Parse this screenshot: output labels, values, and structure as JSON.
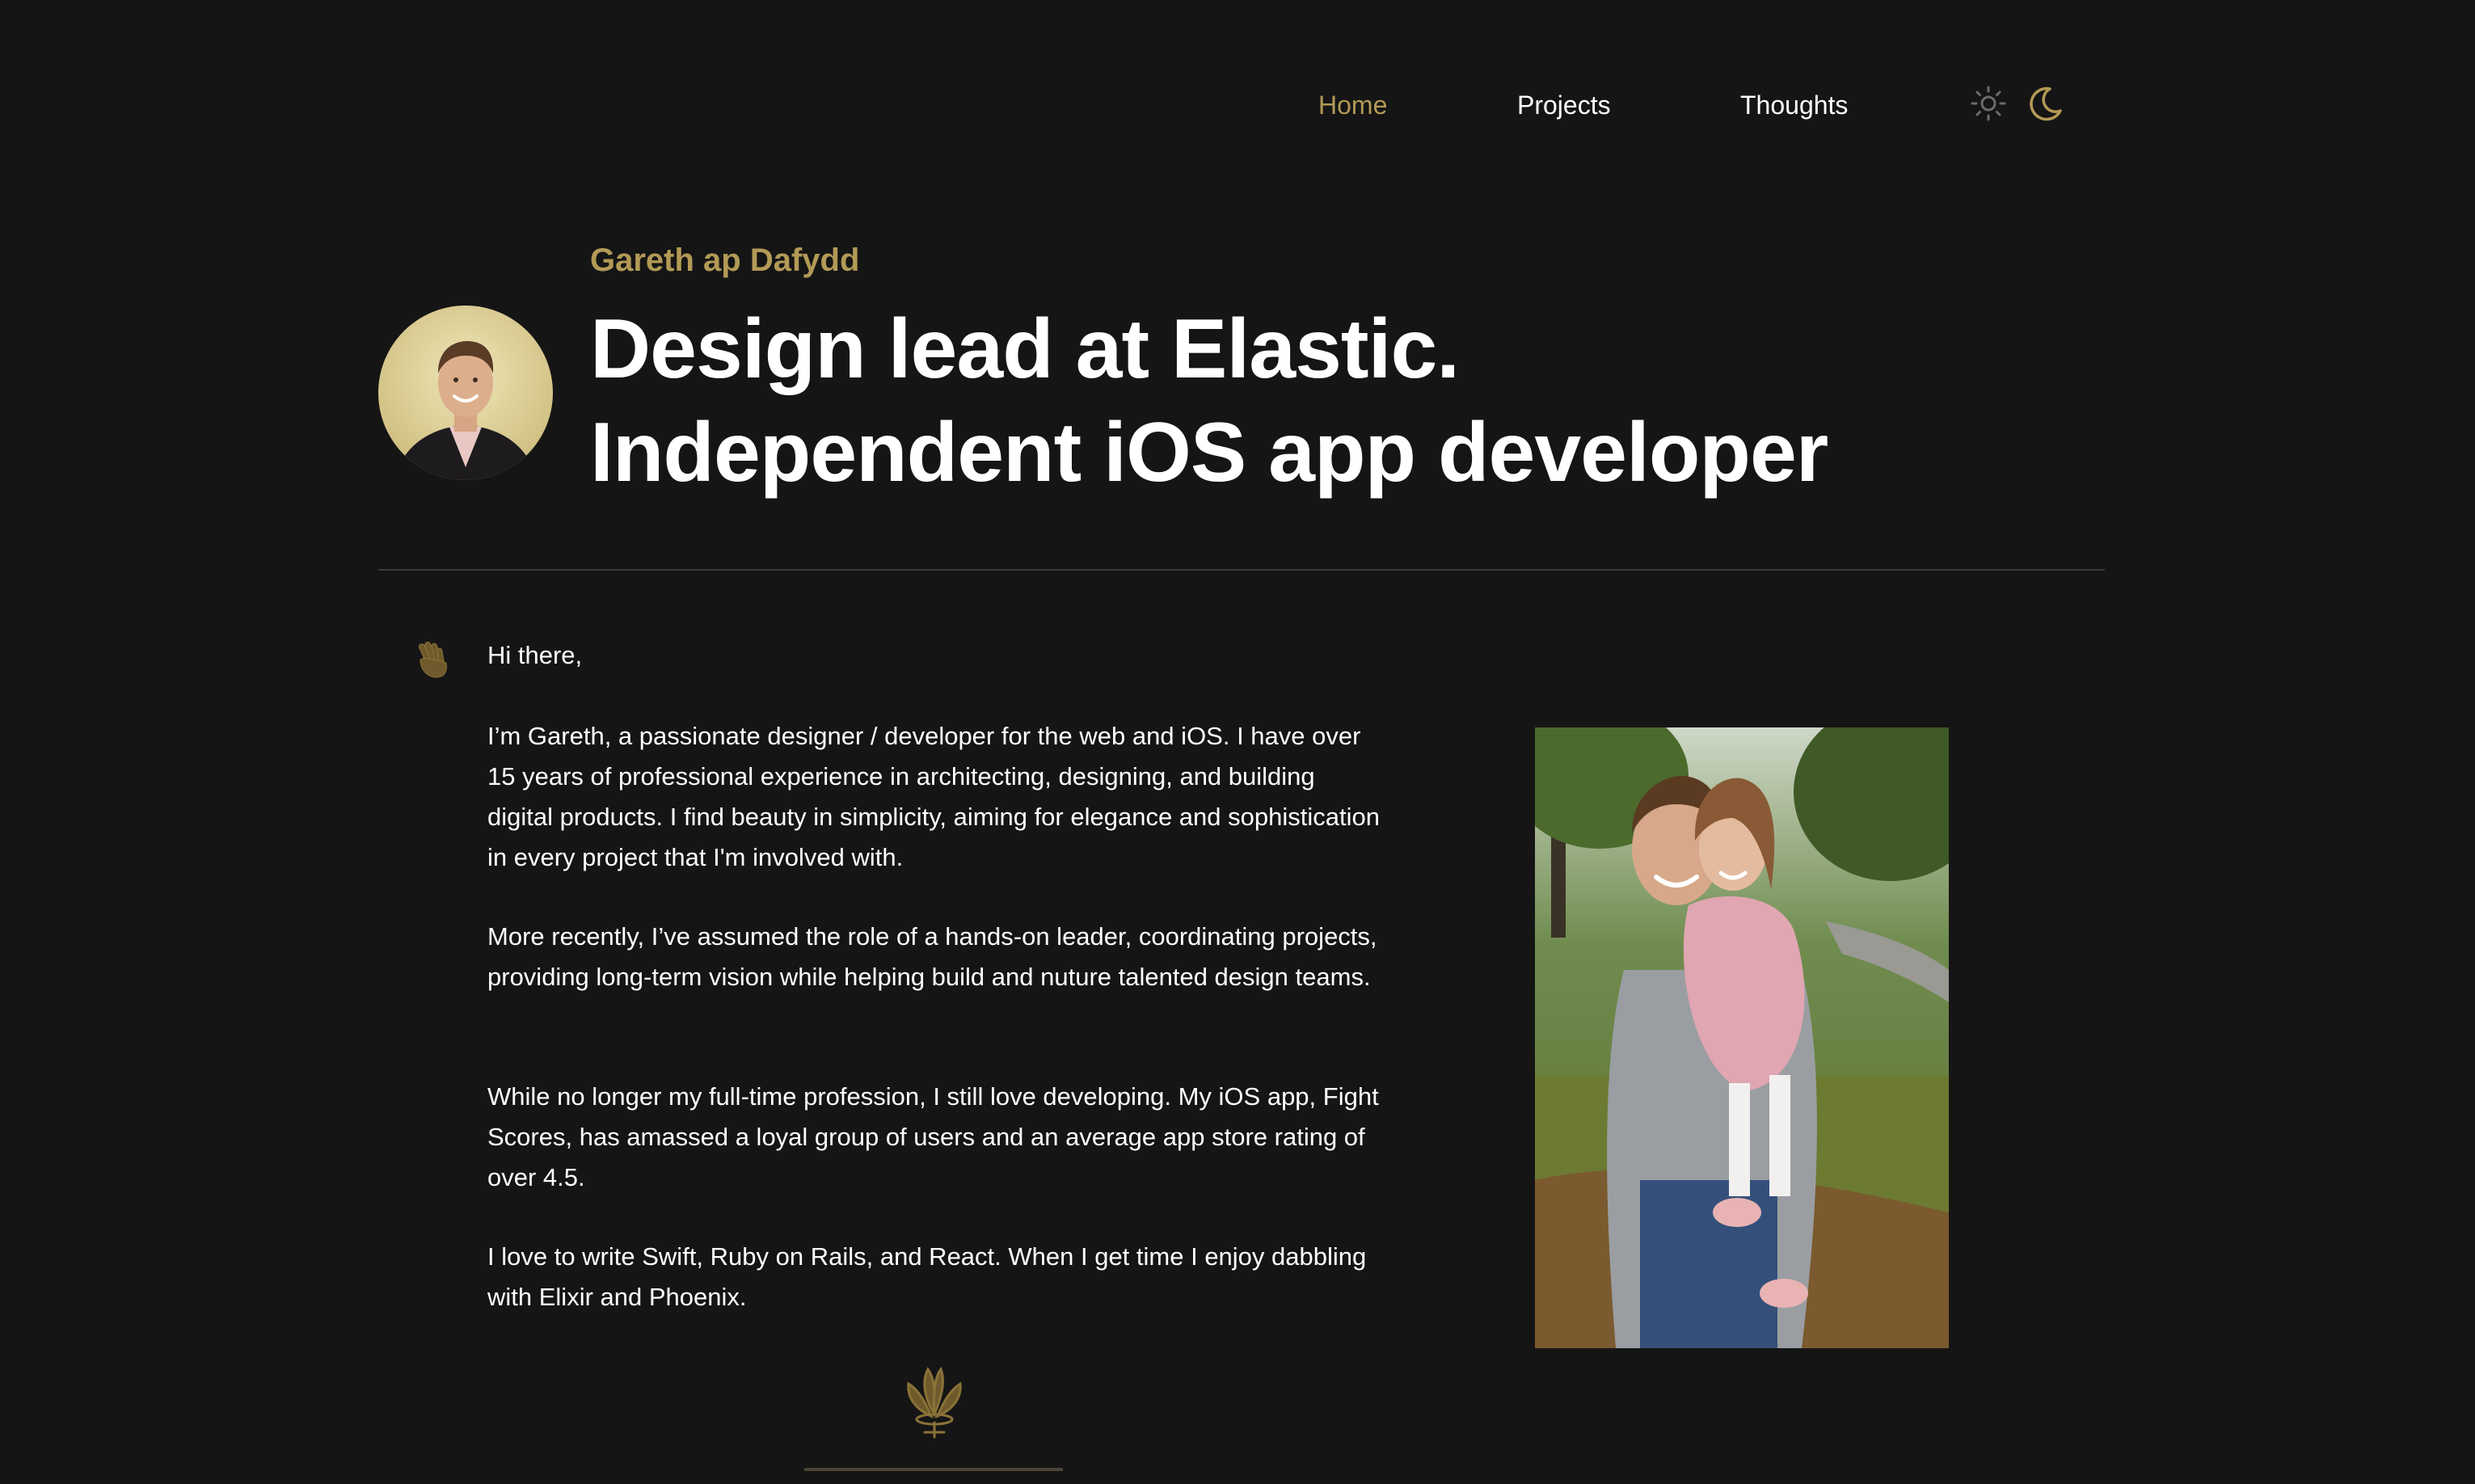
{
  "nav": {
    "items": [
      {
        "label": "Home",
        "active": true
      },
      {
        "label": "Projects",
        "active": false
      },
      {
        "label": "Thoughts",
        "active": false
      }
    ],
    "icons": [
      "sun-icon",
      "moon-icon"
    ]
  },
  "header": {
    "name": "Gareth ap Dafydd",
    "headline_line1": "Design lead at Elastic.",
    "headline_line2": "Independent iOS app developer"
  },
  "intro": {
    "greeting": "Hi there,",
    "paragraphs": [
      "I’m Gareth, a passionate designer / developer for the web and iOS. I have over 15 years of professional experience in architecting, designing, and building digital products. I find beauty in simplicity, aiming for elegance and sophistication in every project that I'm involved with.",
      "More recently, I’ve assumed the role of a hands-on leader, coordinating projects, providing long-term vision while helping build and nuture talented design teams.",
      "While no longer my full-time profession, I still love developing. My iOS app, Fight Scores, has amassed a loyal group of users and an average app store rating of over 4.5.",
      "I love to write Swift, Ruby on Rails, and React. When I get time I enjoy dabbling with Elixir and Phoenix."
    ]
  },
  "colors": {
    "background": "#151515",
    "accent": "#b29a56",
    "text": "#ffffff",
    "divider": "#3a3a3a"
  }
}
